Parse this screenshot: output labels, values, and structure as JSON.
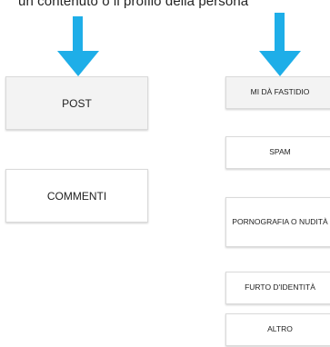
{
  "caption": "un contenuto  o   il profilo della persona",
  "accent_color": "#1eaee8",
  "left_menu": {
    "items": [
      {
        "label": "POST",
        "selected": true
      },
      {
        "label": "COMMENTI",
        "selected": false
      }
    ]
  },
  "right_menu": {
    "items": [
      {
        "label": "MI DÀ FASTIDIO",
        "selected": true
      },
      {
        "label": "SPAM",
        "selected": false
      },
      {
        "label": "PORNOGRAFIA O NUDITÀ",
        "selected": false
      },
      {
        "label": "FURTO D'IDENTITÀ",
        "selected": false
      },
      {
        "label": "ALTRO",
        "selected": false
      }
    ]
  }
}
